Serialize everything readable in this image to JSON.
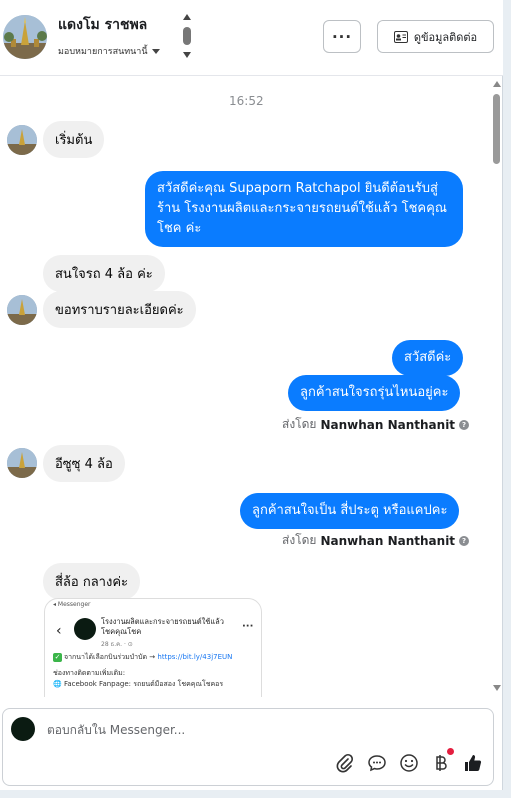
{
  "header": {
    "contact_name": "แดงโม ราชพล",
    "assign_label": "มอบหมายการสนทนานี้",
    "more_label": "···",
    "view_contact_label": "ดูข้อมูลติดต่อ"
  },
  "messages": {
    "timestamp": "16:52",
    "in_1": "เริ่มต้น",
    "out_1": "สวัสดีค่ะคุณ Supaporn Ratchapol ยินดีต้อนรับสู่ร้าน โรงงานผลิตและกระจายรถยนต์ใช้แล้ว โชคคุณโชค ค่ะ",
    "in_2": "สนใจรถ 4 ล้อ ค่ะ",
    "in_3": "ขอทราบรายละเอียดค่ะ",
    "out_2": "สวัสดีค่ะ",
    "out_3": "ลูกค้าสนใจรถรุ่นไหนอยู่คะ",
    "sent_by_label_1": "ส่งโดย",
    "sent_by_name_1": "Nanwhan Nanthanit",
    "in_4": "อีซูซุ 4 ล้อ",
    "out_4": "ลูกค้าสนใจเป็น สี่ประตู หรือแคปคะ",
    "sent_by_label_2": "ส่งโดย",
    "sent_by_name_2": "Nanwhan Nanthanit",
    "in_5": "สี่ล้อ กลางค่ะ"
  },
  "shared_post": {
    "top_label": "◂ Messenger",
    "page_name": "โรงงานผลิตและกระจายรถยนต์ใช้แล้ว โชคคุณโชค",
    "date": "28 ธ.ค. · ⊙",
    "line_1_prefix": "จากนาได้เลือกบินร่วมบำบัด → ",
    "line_1_link": "https://bit.ly/43j7EUN",
    "line_2": "ช่องทางติดตามเพิ่มเติม:",
    "line_3": "🌐 Facebook Fanpage: รถยนต์มือสอง โชคคุณโชคอร"
  },
  "composer": {
    "placeholder": "ตอบกลับใน Messenger..."
  },
  "colors": {
    "outgoing_bubble": "#0a7cff",
    "incoming_bubble": "#f0f0f0",
    "notification_dot": "#e41e3f"
  },
  "icons": {
    "attach": "paperclip-icon",
    "saved_replies": "chat-bubble-icon",
    "emoji": "smiley-icon",
    "currency": "baht-icon",
    "like": "thumbs-up-icon"
  }
}
